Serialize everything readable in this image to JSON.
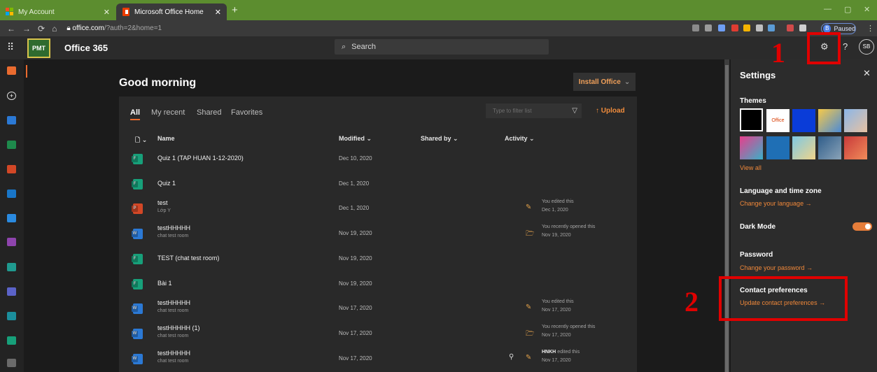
{
  "browser": {
    "tabs": [
      {
        "label": "My Account",
        "active": false
      },
      {
        "label": "Microsoft Office Home",
        "active": true
      }
    ],
    "new_tab": "+",
    "url_host": "office.com",
    "url_path": "/?auth=2&home=1",
    "profile_letter": "B",
    "profile_status": "Paused"
  },
  "header": {
    "logo_text": "PMT",
    "app_name": "Office 365",
    "search_placeholder": "Search",
    "help": "?",
    "avatar": "SB"
  },
  "main": {
    "greeting": "Good morning",
    "install_label": "Install Office",
    "tabs": [
      "All",
      "My recent",
      "Shared",
      "Favorites"
    ],
    "filter_placeholder": "Type to filter list",
    "upload_label": "Upload",
    "columns": {
      "name": "Name",
      "modified": "Modified",
      "shared_by": "Shared by",
      "activity": "Activity"
    },
    "files": [
      {
        "name": "Quiz 1 (TAP HUAN 1-12-2020)",
        "sub": "",
        "date": "Dec 10, 2020",
        "type": "forms",
        "activity_icon": "",
        "activity1": "",
        "activity_who": "",
        "activity2": ""
      },
      {
        "name": "Quiz 1",
        "sub": "",
        "date": "Dec 1, 2020",
        "type": "forms",
        "activity_icon": "",
        "activity1": "",
        "activity_who": "",
        "activity2": ""
      },
      {
        "name": "test",
        "sub": "Lớp Y",
        "date": "Dec 1, 2020",
        "type": "ppt",
        "activity_icon": "pencil-icon",
        "activity1": "You edited this",
        "activity_who": "",
        "activity2": "Dec 1, 2020"
      },
      {
        "name": "testHHHHH",
        "sub": "chat test room",
        "date": "Nov 19, 2020",
        "type": "word",
        "activity_icon": "folder-open-icon",
        "activity1": "You recently opened this",
        "activity_who": "",
        "activity2": "Nov 19, 2020"
      },
      {
        "name": "TEST (chat test room)",
        "sub": "",
        "date": "Nov 19, 2020",
        "type": "forms",
        "activity_icon": "",
        "activity1": "",
        "activity_who": "",
        "activity2": ""
      },
      {
        "name": "Bài 1",
        "sub": "",
        "date": "Nov 19, 2020",
        "type": "forms",
        "activity_icon": "",
        "activity1": "",
        "activity_who": "",
        "activity2": ""
      },
      {
        "name": "testHHHHH",
        "sub": "chat test room",
        "date": "Nov 17, 2020",
        "type": "word",
        "activity_icon": "pencil-icon",
        "activity1": "You edited this",
        "activity_who": "",
        "activity2": "Nov 17, 2020"
      },
      {
        "name": "testHHHHH (1)",
        "sub": "chat test room",
        "date": "Nov 17, 2020",
        "type": "word",
        "activity_icon": "folder-open-icon",
        "activity1": "You recently opened this",
        "activity_who": "",
        "activity2": "Nov 17, 2020"
      },
      {
        "name": "testHHHHH",
        "sub": "chat test room",
        "date": "Nov 17, 2020",
        "type": "word",
        "activity_icon": "pencil-icon",
        "activity1": "edited this",
        "activity_who": "HNKH",
        "activity2": "Nov 17, 2020"
      }
    ]
  },
  "settings": {
    "title": "Settings",
    "themes_label": "Themes",
    "office_theme_label": "Office",
    "view_all": "View all",
    "language_heading": "Language and time zone",
    "language_link": "Change your language →",
    "dark_mode_label": "Dark Mode",
    "dark_mode_on": true,
    "password_heading": "Password",
    "password_link": "Change your password →",
    "contact_heading": "Contact preferences",
    "contact_link": "Update contact preferences →"
  },
  "annotations": {
    "one": "1",
    "two": "2"
  },
  "colors": {
    "accent": "#ea6b2f",
    "annotation": "#e00000",
    "tabbar": "#5c8d2f"
  }
}
